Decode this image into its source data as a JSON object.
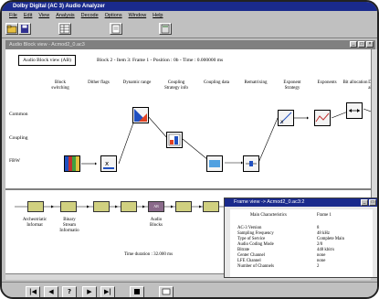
{
  "app": {
    "title": "Dolby Digital (AC 3) Audio Analyzer"
  },
  "menu": [
    "File",
    "Edit",
    "View",
    "Analysis",
    "Decode",
    "Options",
    "Window",
    "Help"
  ],
  "child_window": {
    "title": "Audio Block view - Acmod2_0.ac3"
  },
  "block_view": {
    "button_label": "Audio Block view (AB)",
    "info": "Block 2 - Item 3: Frame 1 - Position : 0b - Time : 0.000000 ms",
    "columns": [
      {
        "label": "Block\nswitching"
      },
      {
        "label": "Dither flags"
      },
      {
        "label": "Dynamic range"
      },
      {
        "label": "Coupling\nStrategy info"
      },
      {
        "label": "Coupling data"
      },
      {
        "label": "Rematrixing"
      },
      {
        "label": "Exponent\nStrategy"
      },
      {
        "label": "Exponents"
      },
      {
        "label": "Bit allocation"
      },
      {
        "label": "D\nal"
      }
    ],
    "rows": [
      {
        "label": "Common"
      },
      {
        "label": "Coupling"
      },
      {
        "label": "FBW"
      }
    ]
  },
  "stream_view": {
    "nodes": [
      "",
      "",
      "",
      "",
      "",
      "",
      "AB",
      ""
    ],
    "labels": [
      {
        "text": "Archeotriatic\nInformat"
      },
      {
        "text": "Binary\nStream\nInformatio"
      },
      {
        "text": "Audio\nBlocks"
      }
    ],
    "time_duration": "Time duration : 32.000 ms"
  },
  "frame_view": {
    "title": "Frame view -> Acmod2_0.ac3:2",
    "header_key": "Main Characteristics",
    "header_val": "Frame 1",
    "rows": [
      {
        "k": "AC-3 Version",
        "v": "8"
      },
      {
        "k": "Sampling Frequency",
        "v": "48 kHz"
      },
      {
        "k": "Type of Service",
        "v": "Complete Main"
      },
      {
        "k": "Audio Coding Mode",
        "v": "2/0"
      },
      {
        "k": "Bitrate",
        "v": "448 kbit/s"
      },
      {
        "k": "Center Channel",
        "v": "none"
      },
      {
        "k": "LFE Channel",
        "v": "none"
      },
      {
        "k": "Number of Channels",
        "v": "2"
      }
    ]
  },
  "navigation": [
    "|◀",
    "◀",
    "?",
    "▶",
    "▶|"
  ]
}
